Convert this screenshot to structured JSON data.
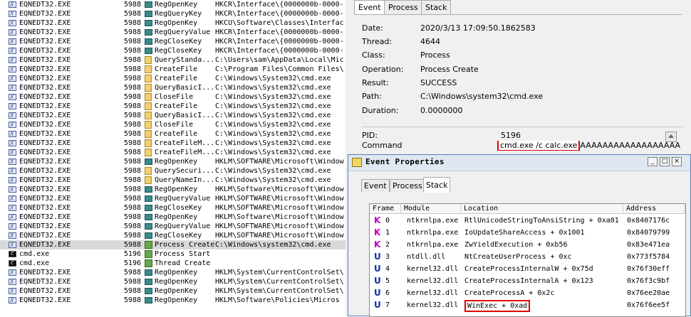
{
  "procmon": {
    "rows": [
      {
        "icon": "exe",
        "process": "EQNEDT32.EXE",
        "pid": "5988",
        "op_icon": "reg",
        "operation": "RegOpenKey",
        "path": "HKCR\\Interface\\{0000000b-0000-"
      },
      {
        "icon": "exe",
        "process": "EQNEDT32.EXE",
        "pid": "5988",
        "op_icon": "reg",
        "operation": "RegQueryKey",
        "path": "HKCR\\Interface\\{0000000b-0000-"
      },
      {
        "icon": "exe",
        "process": "EQNEDT32.EXE",
        "pid": "5988",
        "op_icon": "reg",
        "operation": "RegOpenKey",
        "path": "HKCU\\Software\\Classes\\Interfac"
      },
      {
        "icon": "exe",
        "process": "EQNEDT32.EXE",
        "pid": "5988",
        "op_icon": "reg",
        "operation": "RegQueryValue",
        "path": "HKCR\\Interface\\{0000000b-0000-"
      },
      {
        "icon": "exe",
        "process": "EQNEDT32.EXE",
        "pid": "5988",
        "op_icon": "reg",
        "operation": "RegCloseKey",
        "path": "HKCR\\Interface\\{0000000b-0000-"
      },
      {
        "icon": "exe",
        "process": "EQNEDT32.EXE",
        "pid": "5988",
        "op_icon": "reg",
        "operation": "RegCloseKey",
        "path": "HKCR\\Interface\\{0000000b-0000-"
      },
      {
        "icon": "exe",
        "process": "EQNEDT32.EXE",
        "pid": "5988",
        "op_icon": "file",
        "operation": "QueryStanda...",
        "path": "C:\\Users\\sam\\AppData\\Local\\Mic"
      },
      {
        "icon": "exe",
        "process": "EQNEDT32.EXE",
        "pid": "5988",
        "op_icon": "file",
        "operation": "CreateFile",
        "path": "C:\\Program Files\\Common Files\\"
      },
      {
        "icon": "exe",
        "process": "EQNEDT32.EXE",
        "pid": "5988",
        "op_icon": "file",
        "operation": "CreateFile",
        "path": "C:\\Windows\\System32\\cmd.exe"
      },
      {
        "icon": "exe",
        "process": "EQNEDT32.EXE",
        "pid": "5988",
        "op_icon": "file",
        "operation": "QueryBasicI...",
        "path": "C:\\Windows\\System32\\cmd.exe"
      },
      {
        "icon": "exe",
        "process": "EQNEDT32.EXE",
        "pid": "5988",
        "op_icon": "file",
        "operation": "CloseFile",
        "path": "C:\\Windows\\System32\\cmd.exe"
      },
      {
        "icon": "exe",
        "process": "EQNEDT32.EXE",
        "pid": "5988",
        "op_icon": "file",
        "operation": "CreateFile",
        "path": "C:\\Windows\\System32\\cmd.exe"
      },
      {
        "icon": "exe",
        "process": "EQNEDT32.EXE",
        "pid": "5988",
        "op_icon": "file",
        "operation": "QueryBasicI...",
        "path": "C:\\Windows\\System32\\cmd.exe"
      },
      {
        "icon": "exe",
        "process": "EQNEDT32.EXE",
        "pid": "5988",
        "op_icon": "file",
        "operation": "CloseFile",
        "path": "C:\\Windows\\System32\\cmd.exe"
      },
      {
        "icon": "exe",
        "process": "EQNEDT32.EXE",
        "pid": "5988",
        "op_icon": "file",
        "operation": "CreateFile",
        "path": "C:\\Windows\\System32\\cmd.exe"
      },
      {
        "icon": "exe",
        "process": "EQNEDT32.EXE",
        "pid": "5988",
        "op_icon": "file",
        "operation": "CreateFileM...",
        "path": "C:\\Windows\\System32\\cmd.exe"
      },
      {
        "icon": "exe",
        "process": "EQNEDT32.EXE",
        "pid": "5988",
        "op_icon": "file",
        "operation": "CreateFileM...",
        "path": "C:\\Windows\\System32\\cmd.exe"
      },
      {
        "icon": "exe",
        "process": "EQNEDT32.EXE",
        "pid": "5988",
        "op_icon": "reg",
        "operation": "RegOpenKey",
        "path": "HKLM\\SOFTWARE\\Microsoft\\Window"
      },
      {
        "icon": "exe",
        "process": "EQNEDT32.EXE",
        "pid": "5988",
        "op_icon": "file",
        "operation": "QuerySecuri...",
        "path": "C:\\Windows\\System32\\cmd.exe"
      },
      {
        "icon": "exe",
        "process": "EQNEDT32.EXE",
        "pid": "5988",
        "op_icon": "file",
        "operation": "QueryNameIn...",
        "path": "C:\\Windows\\System32\\cmd.exe"
      },
      {
        "icon": "exe",
        "process": "EQNEDT32.EXE",
        "pid": "5988",
        "op_icon": "reg",
        "operation": "RegOpenKey",
        "path": "HKLM\\Software\\Microsoft\\Window"
      },
      {
        "icon": "exe",
        "process": "EQNEDT32.EXE",
        "pid": "5988",
        "op_icon": "reg",
        "operation": "RegQueryValue",
        "path": "HKLM\\SOFTWARE\\Microsoft\\Window"
      },
      {
        "icon": "exe",
        "process": "EQNEDT32.EXE",
        "pid": "5988",
        "op_icon": "reg",
        "operation": "RegCloseKey",
        "path": "HKLM\\SOFTWARE\\Microsoft\\Window"
      },
      {
        "icon": "exe",
        "process": "EQNEDT32.EXE",
        "pid": "5988",
        "op_icon": "reg",
        "operation": "RegOpenKey",
        "path": "HKLM\\Software\\Microsoft\\Window"
      },
      {
        "icon": "exe",
        "process": "EQNEDT32.EXE",
        "pid": "5988",
        "op_icon": "reg",
        "operation": "RegQueryValue",
        "path": "HKLM\\SOFTWARE\\Microsoft\\Window"
      },
      {
        "icon": "exe",
        "process": "EQNEDT32.EXE",
        "pid": "5988",
        "op_icon": "reg",
        "operation": "RegCloseKey",
        "path": "HKLM\\SOFTWARE\\Microsoft\\Window"
      },
      {
        "icon": "exe",
        "process": "EQNEDT32.EXE",
        "pid": "5988",
        "op_icon": "proc",
        "operation": "Process Create",
        "path": "C:\\Windows\\system32\\cmd.exe",
        "selected": true
      },
      {
        "icon": "cmd",
        "process": "cmd.exe",
        "pid": "5196",
        "op_icon": "proc",
        "operation": "Process Start",
        "path": ""
      },
      {
        "icon": "cmd",
        "process": "cmd.exe",
        "pid": "5196",
        "op_icon": "proc",
        "operation": "Thread Create",
        "path": ""
      },
      {
        "icon": "exe",
        "process": "EQNEDT32.EXE",
        "pid": "5988",
        "op_icon": "reg",
        "operation": "RegOpenKey",
        "path": "HKLM\\System\\CurrentControlSet\\"
      },
      {
        "icon": "exe",
        "process": "EQNEDT32.EXE",
        "pid": "5988",
        "op_icon": "reg",
        "operation": "RegOpenKey",
        "path": "HKLM\\System\\CurrentControlSet\\"
      },
      {
        "icon": "exe",
        "process": "EQNEDT32.EXE",
        "pid": "5988",
        "op_icon": "reg",
        "operation": "RegOpenKey",
        "path": "HKLM\\System\\CurrentControlSet\\"
      },
      {
        "icon": "exe",
        "process": "EQNEDT32.EXE",
        "pid": "5988",
        "op_icon": "reg",
        "operation": "RegOpenKey",
        "path": "HKLM\\Software\\Policies\\Micros"
      }
    ]
  },
  "event_panel": {
    "tabs": [
      "Event",
      "Process",
      "Stack"
    ],
    "fields": [
      {
        "label": "Date:",
        "value": "2020/3/13 17:09:50.1862583"
      },
      {
        "label": "Thread:",
        "value": "4644"
      },
      {
        "label": "Class:",
        "value": "Process"
      },
      {
        "label": "Operation:",
        "value": "Process Create"
      },
      {
        "label": "Result:",
        "value": "SUCCESS"
      },
      {
        "label": "Path:",
        "value": "C:\\Windows\\system32\\cmd.exe"
      },
      {
        "label": "Duration:",
        "value": "0.0000000"
      }
    ],
    "pid_label": "PID:",
    "pid_value": "5196",
    "cmdline_label": "Command line:",
    "cmdline_highlight": "cmd.exe /c calc.exe",
    "cmdline_rest": "AAAAAAAAAAAAAAAAAA"
  },
  "dialog": {
    "title": "Event Properties",
    "tabs": [
      "Event",
      "Process",
      "Stack"
    ],
    "columns": [
      "Frame",
      "Module",
      "Location",
      "Address"
    ],
    "frames": [
      {
        "mode": "K",
        "frame": "0",
        "module": "ntkrnlpa.exe",
        "location": "RtlUnicodeStringToAnsiString + 0xa01",
        "address": "0x8407176c"
      },
      {
        "mode": "K",
        "frame": "1",
        "module": "ntkrnlpa.exe",
        "location": "IoUpdateShareAccess + 0x1001",
        "address": "0x84079799"
      },
      {
        "mode": "K",
        "frame": "2",
        "module": "ntkrnlpa.exe",
        "location": "ZwYieldExecution + 0xb56",
        "address": "0x83e471ea"
      },
      {
        "mode": "U",
        "frame": "3",
        "module": "ntdll.dll",
        "location": "NtCreateUserProcess + 0xc",
        "address": "0x773f5784"
      },
      {
        "mode": "U",
        "frame": "4",
        "module": "kernel32.dll",
        "location": "CreateProcessInternalW + 0x75d",
        "address": "0x76f30eff"
      },
      {
        "mode": "U",
        "frame": "5",
        "module": "kernel32.dll",
        "location": "CreateProcessInternalA + 0x123",
        "address": "0x76f3c9bf"
      },
      {
        "mode": "U",
        "frame": "6",
        "module": "kernel32.dll",
        "location": "CreateProcessA + 0x2c",
        "address": "0x76ee20ae"
      },
      {
        "mode": "U",
        "frame": "7",
        "module": "kernel32.dll",
        "location": "WinExec + 0xad",
        "address": "0x76f6ee5f",
        "highlight": true
      }
    ]
  },
  "colors": {
    "highlight_border": "#e00000",
    "kernel_mode": "#c000c0",
    "user_mode": "#1030a0",
    "selected_row": "#d9d9d9"
  }
}
